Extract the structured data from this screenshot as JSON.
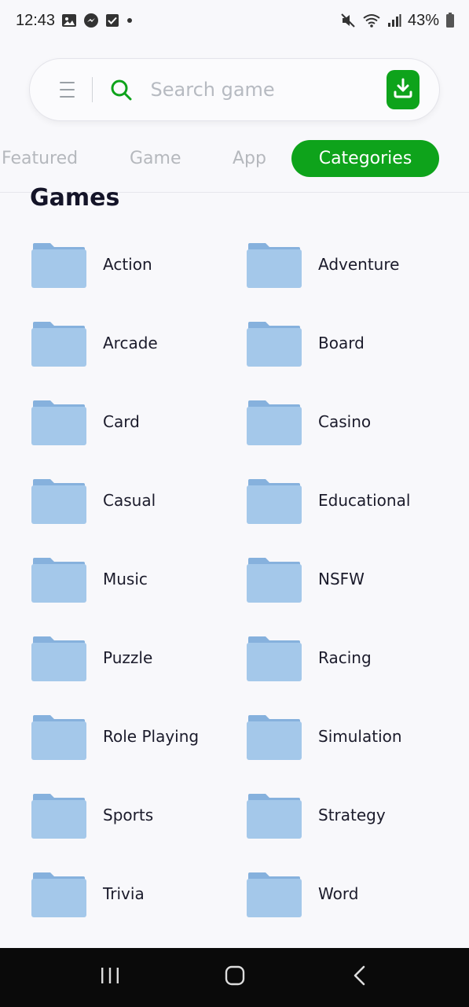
{
  "status_bar": {
    "time": "12:43",
    "battery": "43%",
    "left_icons": [
      "gallery-icon",
      "messenger-icon",
      "checkbox-icon",
      "dot-icon"
    ],
    "right_icons": [
      "mute-icon",
      "wifi-icon",
      "signal-icon",
      "battery-icon"
    ]
  },
  "search": {
    "placeholder": "Search game",
    "value": ""
  },
  "tabs": [
    {
      "label": "Featured",
      "active": false
    },
    {
      "label": "Game",
      "active": false
    },
    {
      "label": "App",
      "active": false
    },
    {
      "label": "Categories",
      "active": true
    }
  ],
  "section": {
    "title": "Games"
  },
  "categories": [
    "Action",
    "Adventure",
    "Arcade",
    "Board",
    "Card",
    "Casino",
    "Casual",
    "Educational",
    "Music",
    "NSFW",
    "Puzzle",
    "Racing",
    "Role Playing",
    "Simulation",
    "Sports",
    "Strategy",
    "Trivia",
    "Word"
  ],
  "colors": {
    "accent": "#0ea31b",
    "folder_front": "#a4c8ea",
    "folder_back": "#86b1dd",
    "background": "#f8f8fb"
  }
}
